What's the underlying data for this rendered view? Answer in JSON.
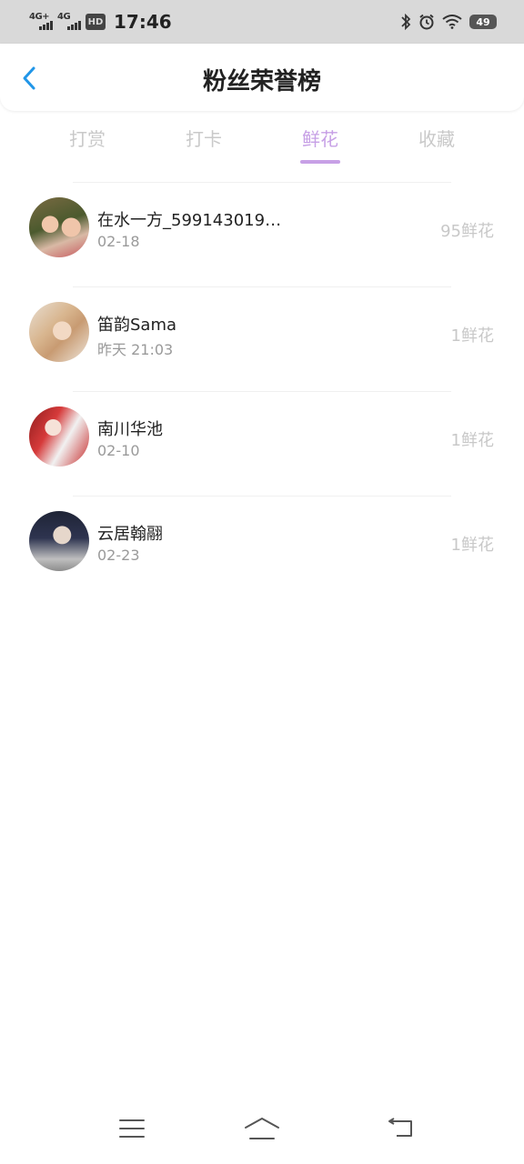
{
  "status_bar": {
    "net1": "4G+",
    "net2": "4G",
    "hd": "HD",
    "time": "17:46",
    "battery": "49"
  },
  "header": {
    "title": "粉丝荣誉榜"
  },
  "tabs": [
    {
      "label": "打赏"
    },
    {
      "label": "打卡"
    },
    {
      "label": "鲜花"
    },
    {
      "label": "收藏"
    }
  ],
  "active_tab_color": "#c7a0e6",
  "fans": [
    {
      "name": "在水一方_599143019…",
      "date": "02-18",
      "count": "95鲜花"
    },
    {
      "name": "笛韵Sama",
      "date": "昨天 21:03",
      "count": "1鲜花"
    },
    {
      "name": "南川华池",
      "date": "02-10",
      "count": "1鲜花"
    },
    {
      "name": "云居翰翮",
      "date": "02-23",
      "count": "1鲜花"
    }
  ]
}
